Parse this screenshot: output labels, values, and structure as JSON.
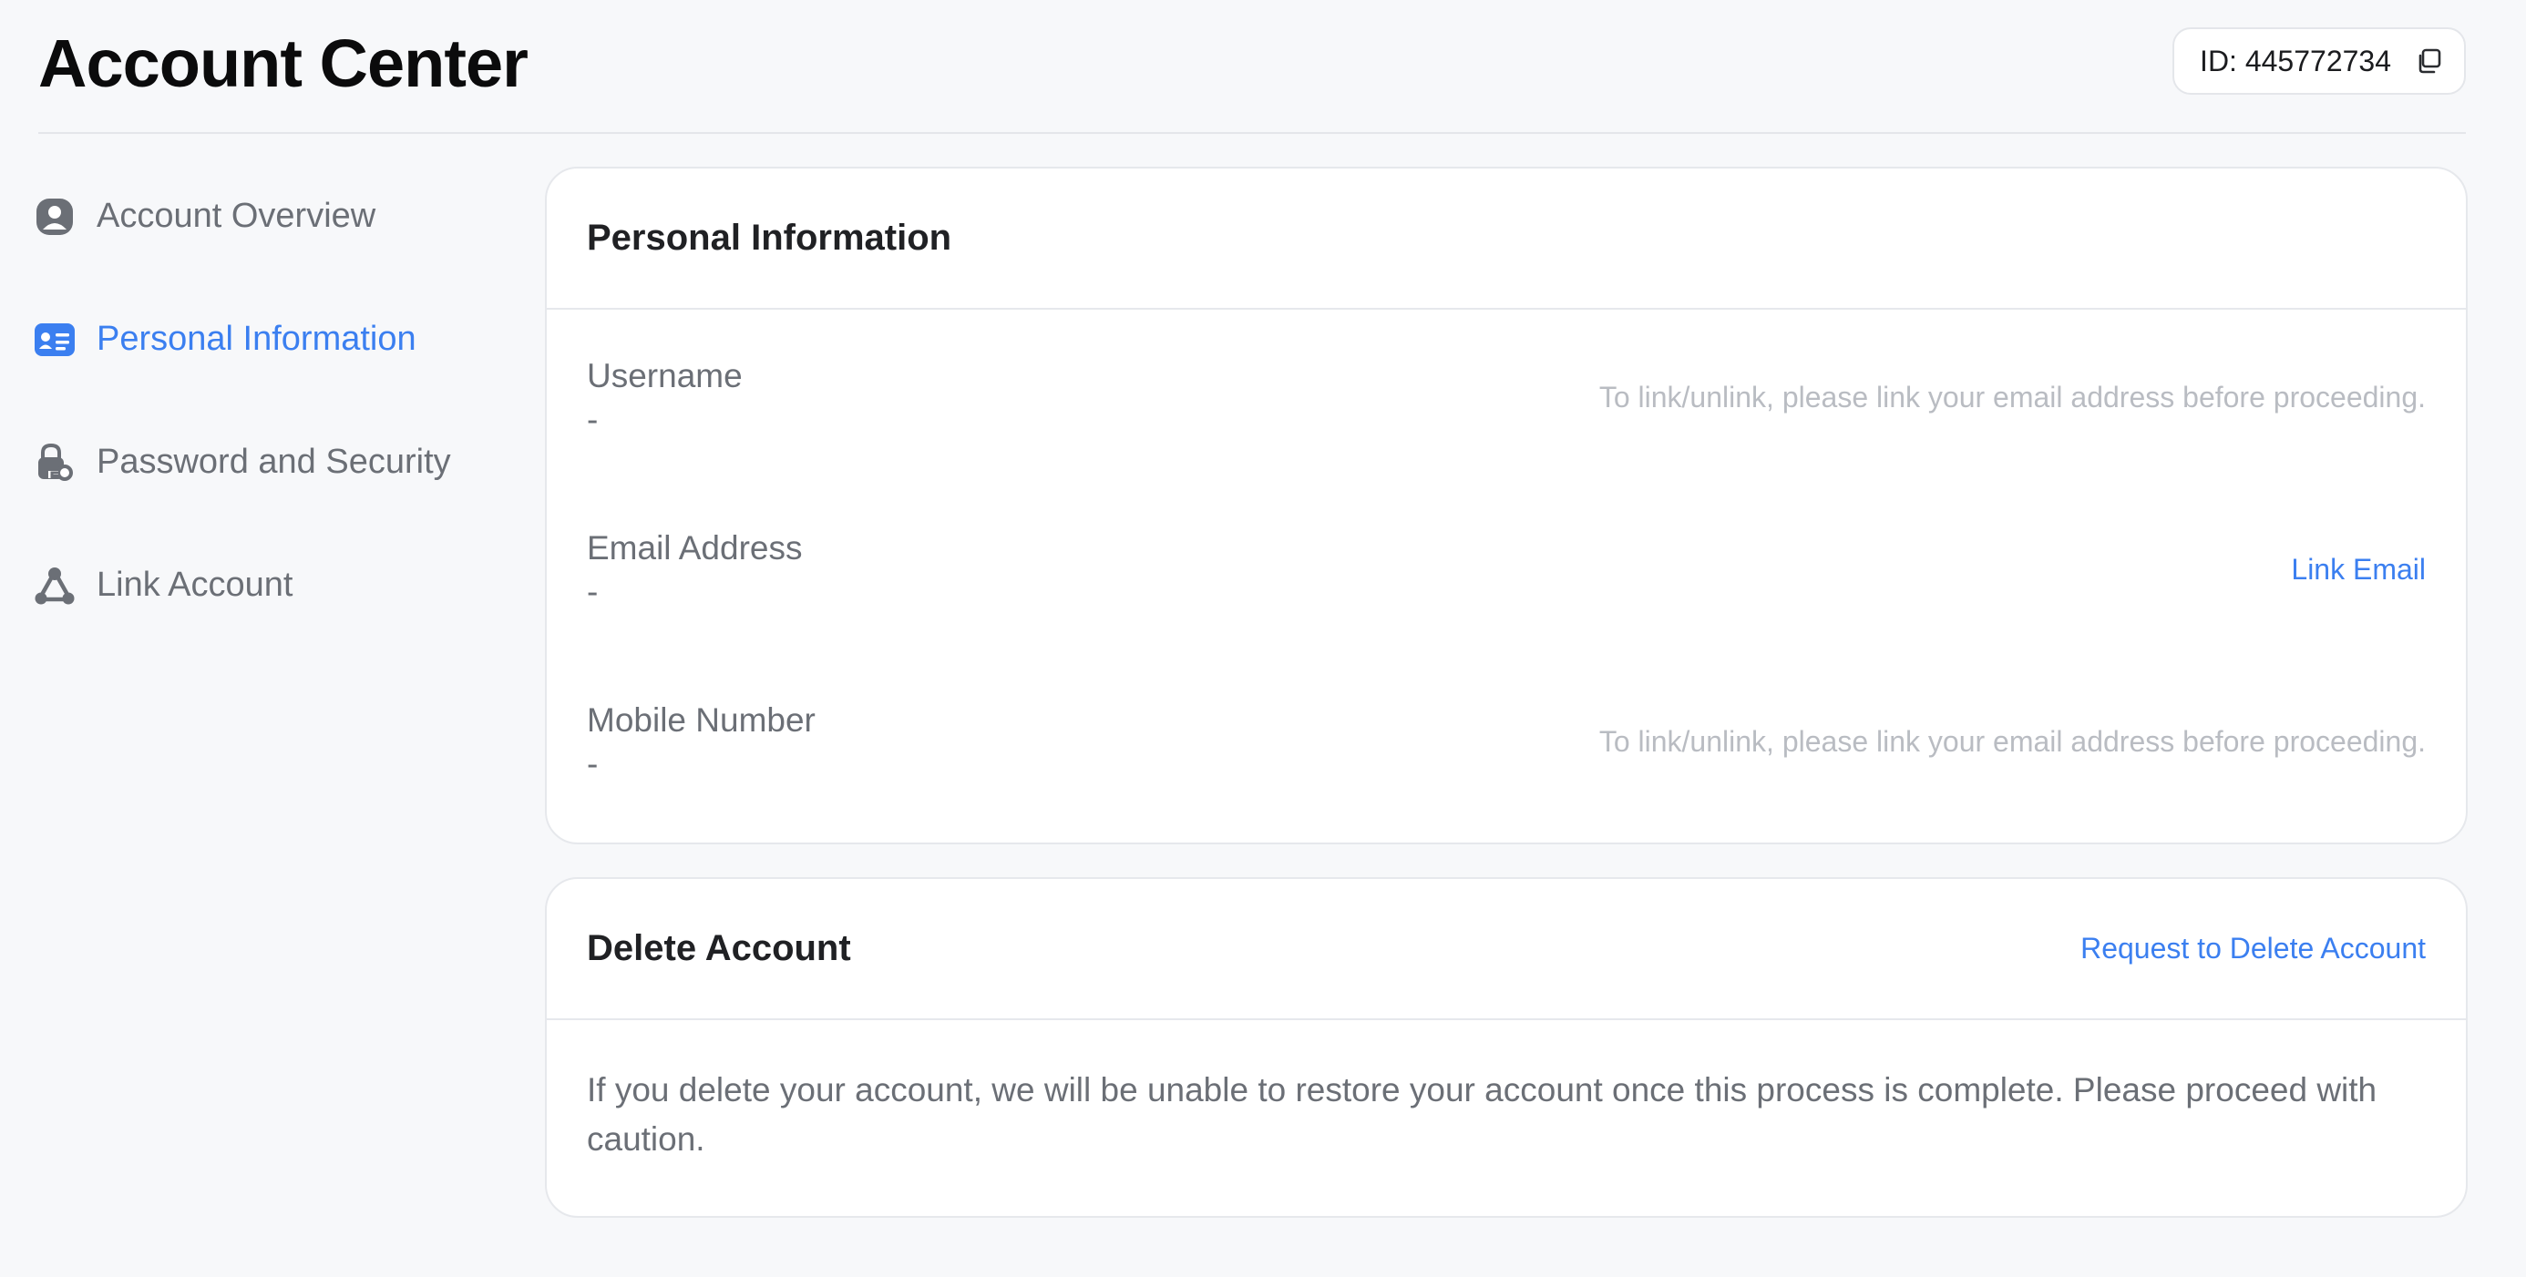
{
  "header": {
    "title": "Account Center",
    "id_text": "ID: 445772734",
    "copy_icon": "copy-icon"
  },
  "sidebar": {
    "items": [
      {
        "label": "Account Overview",
        "icon": "user-circle-icon",
        "active": false
      },
      {
        "label": "Personal Information",
        "icon": "id-card-icon",
        "active": true
      },
      {
        "label": "Password and Security",
        "icon": "lock-key-icon",
        "active": false
      },
      {
        "label": "Link Account",
        "icon": "link-account-icon",
        "active": false
      }
    ]
  },
  "personal_info": {
    "title": "Personal Information",
    "rows": [
      {
        "label": "Username",
        "value": "-",
        "hint": "To link/unlink, please link your email address before proceeding."
      },
      {
        "label": "Email Address",
        "value": "-",
        "action": "Link Email"
      },
      {
        "label": "Mobile Number",
        "value": "-",
        "hint": "To link/unlink, please link your email address before proceeding."
      }
    ]
  },
  "delete_account": {
    "title": "Delete Account",
    "action": "Request to Delete Account",
    "description": "If you delete your account, we will be unable to restore your account once this process is complete. Please proceed with caution."
  },
  "colors": {
    "accent": "#3b7ff0",
    "background": "#f7f8fa",
    "muted_text": "#6b6f76",
    "hint_text": "#b9bcc2"
  }
}
